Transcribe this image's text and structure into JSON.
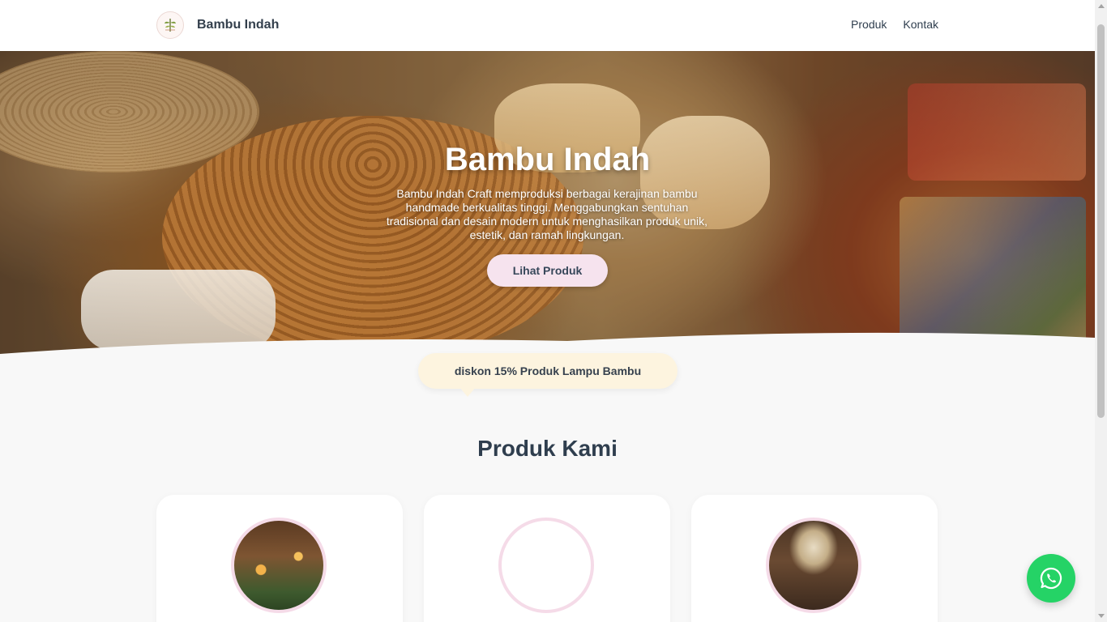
{
  "navbar": {
    "brand": "Bambu Indah",
    "logo_icon": "bamboo-logo-icon",
    "links": [
      {
        "label": "Produk"
      },
      {
        "label": "Kontak"
      }
    ]
  },
  "hero": {
    "title": "Bambu Indah",
    "description": "Bambu Indah Craft memproduksi berbagai kerajinan bambu handmade berkualitas tinggi. Menggabungkan sentuhan tradisional dan desain modern untuk menghasilkan produk unik, estetik, dan ramah lingkungan.",
    "cta_label": "Lihat Produk"
  },
  "promo": {
    "text": "diskon 15% Produk Lampu Bambu"
  },
  "products_section": {
    "title": "Produk Kami",
    "cards": [
      {
        "image": "bamboo-lamps-photo"
      },
      {
        "image": "bamboo-tissue-box-photo"
      },
      {
        "image": "bamboo-vase-photo"
      }
    ]
  },
  "floating": {
    "whatsapp_icon": "whatsapp-icon"
  },
  "colors": {
    "accent_button": "#f6e3ee",
    "promo_bg": "#fdf4df",
    "whatsapp": "#25d366",
    "text_dark": "#2f3e4e"
  }
}
